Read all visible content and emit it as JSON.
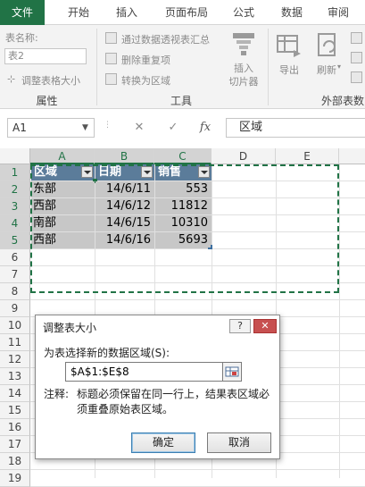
{
  "tabs": [
    "文件",
    "开始",
    "插入",
    "页面布局",
    "公式",
    "数据",
    "审阅"
  ],
  "ribbon": {
    "table_name_label": "表名称:",
    "table_name_value": "表2",
    "resize_label": "调整表格大小",
    "group_properties": "属性",
    "summarize_pivot": "通过数据透视表汇总",
    "remove_duplicates": "删除重复项",
    "convert_to_range": "转换为区域",
    "group_tools": "工具",
    "insert_slicer_line1": "插入",
    "insert_slicer_line2": "切片器",
    "export": "导出",
    "refresh": "刷新",
    "group_external": "外部表数"
  },
  "formula_bar": {
    "name_box": "A1",
    "cancel_icon": "✕",
    "enter_icon": "✓",
    "fx": "fx",
    "content": "区域"
  },
  "grid": {
    "columns": [
      "A",
      "B",
      "C",
      "D",
      "E"
    ],
    "rows": [
      "1",
      "2",
      "3",
      "4",
      "5",
      "6",
      "7",
      "8",
      "9",
      "10",
      "11",
      "12",
      "13",
      "14",
      "15",
      "16",
      "17",
      "18",
      "19"
    ],
    "headers": [
      "区域",
      "日期",
      "销售"
    ],
    "data": [
      [
        "东部",
        "14/6/11",
        "553"
      ],
      [
        "西部",
        "14/6/12",
        "11812"
      ],
      [
        "南部",
        "14/6/15",
        "10310"
      ],
      [
        "西部",
        "14/6/16",
        "5693"
      ]
    ]
  },
  "dialog": {
    "title": "调整表大小",
    "help_icon": "?",
    "close_icon": "✕",
    "prompt": "为表选择新的数据区域(S):",
    "range_value": "$A$1:$E$8",
    "note_key": "注释:",
    "note_text": "标题必须保留在同一行上，结果表区域必须重叠原始表区域。",
    "ok": "确定",
    "cancel": "取消"
  },
  "colors": {
    "excel_green": "#217346",
    "table_header": "#5b7c9a",
    "table_body": "#c7c7c7"
  }
}
